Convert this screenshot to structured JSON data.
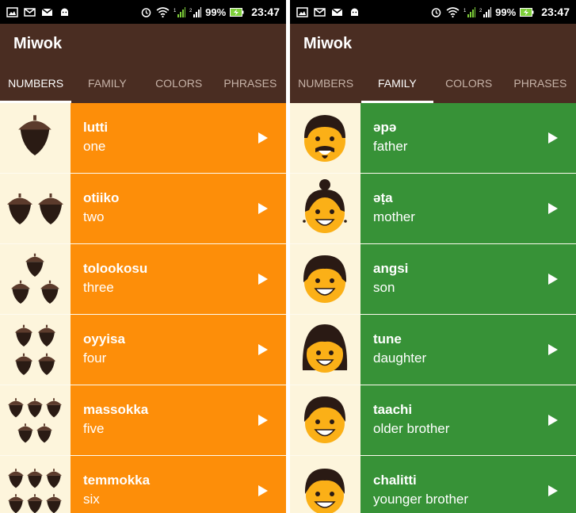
{
  "colors": {
    "status_bar": "#000000",
    "app_bar": "#4a2d22",
    "numbers_category": "#fd8e09",
    "family_category": "#379237",
    "image_background": "#fdf5dc"
  },
  "screens": [
    {
      "status_bar": {
        "icons": [
          "picture-icon",
          "mail-icon",
          "gmail-icon",
          "android-icon",
          "alarm-icon",
          "wifi-icon",
          "signal-1-icon",
          "signal-2-icon",
          "battery-charging-icon"
        ],
        "battery": "99%",
        "time": "23:47"
      },
      "app_title": "Miwok",
      "tabs": [
        "NUMBERS",
        "FAMILY",
        "COLORS",
        "PHRASES"
      ],
      "active_tab": "NUMBERS",
      "items": [
        {
          "miwok": "lutti",
          "english": "one",
          "image": "acorn-1"
        },
        {
          "miwok": "otiiko",
          "english": "two",
          "image": "acorn-2"
        },
        {
          "miwok": "tolookosu",
          "english": "three",
          "image": "acorn-3"
        },
        {
          "miwok": "oyyisa",
          "english": "four",
          "image": "acorn-4"
        },
        {
          "miwok": "massokka",
          "english": "five",
          "image": "acorn-5"
        },
        {
          "miwok": "temmokka",
          "english": "six",
          "image": "acorn-6"
        }
      ]
    },
    {
      "status_bar": {
        "icons": [
          "picture-icon",
          "mail-icon",
          "gmail-icon",
          "android-icon",
          "alarm-icon",
          "wifi-icon",
          "signal-1-icon",
          "signal-2-icon",
          "battery-charging-icon"
        ],
        "battery": "99%",
        "time": "23:47"
      },
      "app_title": "Miwok",
      "tabs": [
        "NUMBERS",
        "FAMILY",
        "COLORS",
        "PHRASES"
      ],
      "active_tab": "FAMILY",
      "items": [
        {
          "miwok": "әpә",
          "english": "father",
          "image": "father-face"
        },
        {
          "miwok": "әṭa",
          "english": "mother",
          "image": "mother-face"
        },
        {
          "miwok": "angsi",
          "english": "son",
          "image": "son-face"
        },
        {
          "miwok": "tune",
          "english": "daughter",
          "image": "daughter-face"
        },
        {
          "miwok": "taachi",
          "english": "older brother",
          "image": "older-brother-face"
        },
        {
          "miwok": "chalitti",
          "english": "younger brother",
          "image": "younger-brother-face"
        }
      ]
    }
  ]
}
